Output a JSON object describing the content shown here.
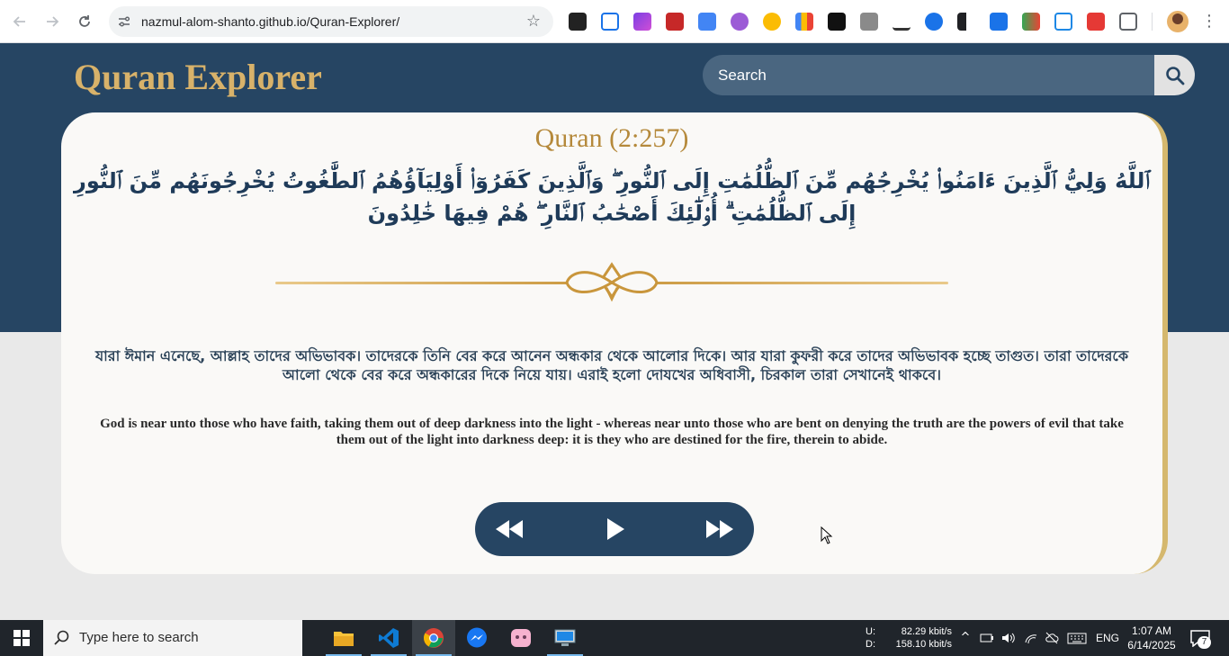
{
  "browser": {
    "url": "nazmul-alom-shanto.github.io/Quran-Explorer/",
    "back_icon": "arrow-left-icon",
    "forward_icon": "arrow-right-icon",
    "reload_icon": "reload-icon",
    "bookmark_icon": "star-icon",
    "menu_icon": "more-vert-icon"
  },
  "site": {
    "title": "Quran Explorer",
    "search_placeholder": "Search",
    "search_icon": "magnifier-icon"
  },
  "verse": {
    "reference": "Quran (2:257)",
    "arabic": "ٱللَّهُ وَلِيُّ ٱلَّذِينَ ءَامَنُوا۟ يُخْرِجُهُم مِّنَ ٱلظُّلُمَٰتِ إِلَى ٱلنُّورِ ۖ وَٱلَّذِينَ كَفَرُوٓا۟ أَوْلِيَآؤُهُمُ ٱلطَّٰغُوتُ يُخْرِجُونَهُم مِّنَ ٱلنُّورِ إِلَى ٱلظُّلُمَٰتِ ۗ أُو۟لَٰٓئِكَ أَصْحَٰبُ ٱلنَّارِ ۖ هُمْ فِيهَا خَٰلِدُونَ",
    "bengali": "যারা ঈমান এনেছে, আল্লাহ তাদের অভিভাবক। তাদেরকে তিনি বের করে আনেন অন্ধকার থেকে আলোর দিকে। আর যারা কুফরী করে তাদের অভিভাবক হচ্ছে তাগুত। তারা তাদেরকে আলো থেকে বের করে অন্ধকারের দিকে নিয়ে যায়। এরাই হলো দোযখের অধিবাসী, চিরকাল তারা সেখানেই থাকবে।",
    "english": "God is near unto those who have faith, taking them out of deep darkness into the light - whereas near unto those who are bent on denying the truth are the powers of evil that take them out of the light into darkness deep: it is they who are destined for the fire, therein to abide."
  },
  "player": {
    "previous_icon": "rewind-icon",
    "play_icon": "play-icon",
    "next_icon": "fast-forward-icon"
  },
  "taskbar": {
    "search_placeholder": "Type here to search",
    "net_upload_label": "U:",
    "net_download_label": "D:",
    "net_upload": "82.29 kbit/s",
    "net_download": "158.10 kbit/s",
    "language": "ENG",
    "time": "1:07 AM",
    "date": "6/14/2025",
    "notification_count": "7",
    "apps": [
      "file-explorer-icon",
      "vscode-icon",
      "chrome-icon",
      "messenger-icon",
      "pink-app-icon",
      "remote-desktop-icon"
    ]
  },
  "colors": {
    "header_navy": "#264563",
    "gold_accent": "#d8b26a",
    "card_background": "#faf9f7",
    "page_background": "#e9e9e9"
  }
}
